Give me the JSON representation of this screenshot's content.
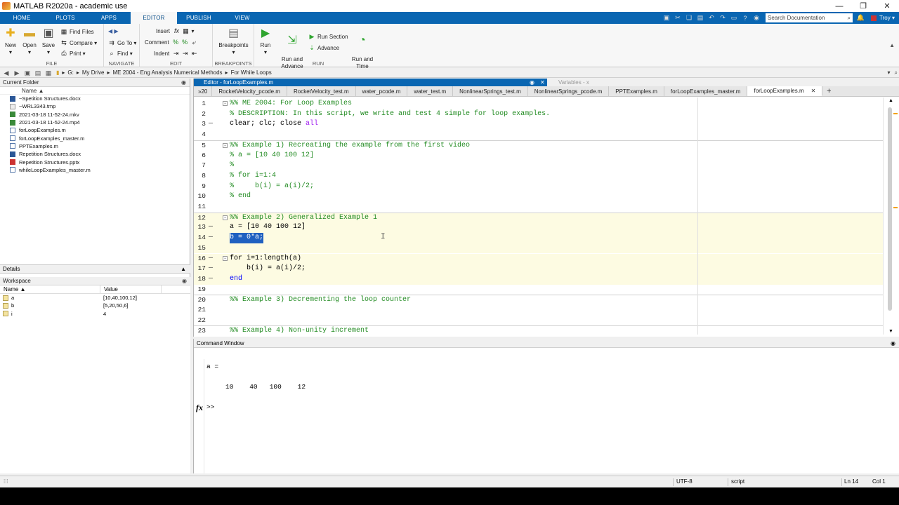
{
  "window": {
    "title": "MATLAB R2020a - academic use",
    "controls": [
      "—",
      "❐",
      "✕"
    ]
  },
  "ribbon": {
    "tabs": [
      "HOME",
      "PLOTS",
      "APPS",
      "EDITOR",
      "PUBLISH",
      "VIEW"
    ],
    "active_tab": "EDITOR",
    "search_placeholder": "Search Documentation",
    "user": "Troy"
  },
  "toolstrip": {
    "file": {
      "name": "FILE",
      "new": "New",
      "open": "Open",
      "save": "Save",
      "find_files": "Find Files",
      "compare": "Compare",
      "print": "Print"
    },
    "navigate": {
      "name": "NAVIGATE",
      "goto": "Go To",
      "find": "Find"
    },
    "edit": {
      "name": "EDIT",
      "insert": "Insert",
      "comment": "Comment",
      "indent": "Indent"
    },
    "breakpoints": {
      "name": "BREAKPOINTS",
      "label": "Breakpoints"
    },
    "run": {
      "name": "RUN",
      "run": "Run",
      "run_advance": "Run and\nAdvance",
      "run_section": "Run Section",
      "advance": "Advance",
      "run_time": "Run and\nTime"
    }
  },
  "address": {
    "drive": "G:",
    "parts": [
      "My Drive",
      "ME 2004 - Eng Analysis Numerical Methods",
      "For While Loops"
    ]
  },
  "current_folder": {
    "title": "Current Folder",
    "col_name": "Name ▲",
    "files": [
      {
        "name": "~Spetition Structures.docx",
        "type": "word"
      },
      {
        "name": "~WRL3343.tmp",
        "type": "tmp"
      },
      {
        "name": "2021-03-18 11-52-24.mkv",
        "type": "video"
      },
      {
        "name": "2021-03-18 11-52-24.mp4",
        "type": "video"
      },
      {
        "name": "forLoopExamples.m",
        "type": "mfile"
      },
      {
        "name": "forLoopExamples_master.m",
        "type": "mfile"
      },
      {
        "name": "PPTExamples.m",
        "type": "mfile"
      },
      {
        "name": "Repetition Structures.docx",
        "type": "word"
      },
      {
        "name": "Repetition Structures.pptx",
        "type": "ppt"
      },
      {
        "name": "whileLoopExamples_master.m",
        "type": "mfile"
      }
    ]
  },
  "details": {
    "title": "Details"
  },
  "workspace": {
    "title": "Workspace",
    "col_name": "Name ▲",
    "col_value": "Value",
    "vars": [
      {
        "name": "a",
        "value": "[10,40,100,12]"
      },
      {
        "name": "b",
        "value": "[5,20,50,6]"
      },
      {
        "name": "i",
        "value": "4"
      }
    ]
  },
  "editor": {
    "title": "Editor - forLoopExamples.m",
    "variables_title": "Variables - x",
    "overflow_tab": "»20",
    "tabs": [
      "RocketVelocity_pcode.m",
      "RocketVelocity_test.m",
      "water_pcode.m",
      "water_test.m",
      "NonlinearSprings_test.m",
      "NonlinearSprings_pcode.m",
      "PPTExamples.m",
      "forLoopExamples_master.m",
      "forLoopExamples.m"
    ],
    "active_tab": "forLoopExamples.m",
    "lines": [
      {
        "n": "1",
        "text": "%% ME 2004: For Loop Examples"
      },
      {
        "n": "2",
        "text": "% DESCRIPTION: In this script, we write and test 4 simple for loop examples."
      },
      {
        "n": "3",
        "text": "clear; clc; close all"
      },
      {
        "n": "4",
        "text": ""
      },
      {
        "n": "5",
        "text": "%% Example 1) Recreating the example from the first video"
      },
      {
        "n": "6",
        "text": "% a = [10 40 100 12]"
      },
      {
        "n": "7",
        "text": "%"
      },
      {
        "n": "8",
        "text": "% for i=1:4"
      },
      {
        "n": "9",
        "text": "%     b(i) = a(i)/2;"
      },
      {
        "n": "10",
        "text": "% end"
      },
      {
        "n": "11",
        "text": ""
      },
      {
        "n": "12",
        "text": "%% Example 2) Generalized Example 1"
      },
      {
        "n": "13",
        "text": "a = [10 40 100 12]"
      },
      {
        "n": "14",
        "text": "b = 0*a;"
      },
      {
        "n": "15",
        "text": ""
      },
      {
        "n": "16",
        "text": "for i=1:length(a)"
      },
      {
        "n": "17",
        "text": "    b(i) = a(i)/2;"
      },
      {
        "n": "18",
        "text": "end"
      },
      {
        "n": "19",
        "text": ""
      },
      {
        "n": "20",
        "text": "%% Example 3) Decrementing the loop counter"
      },
      {
        "n": "21",
        "text": ""
      },
      {
        "n": "22",
        "text": ""
      },
      {
        "n": "23",
        "text": "%% Example 4) Non-unity increment"
      }
    ]
  },
  "command_window": {
    "title": "Command Window",
    "output_var": "a =",
    "output_values": "10    40   100    12",
    "prompt": ">>",
    "fx": "fx"
  },
  "status": {
    "encoding": "UTF-8",
    "mode": "script",
    "ln": "Ln  14",
    "col": "Col  1"
  }
}
